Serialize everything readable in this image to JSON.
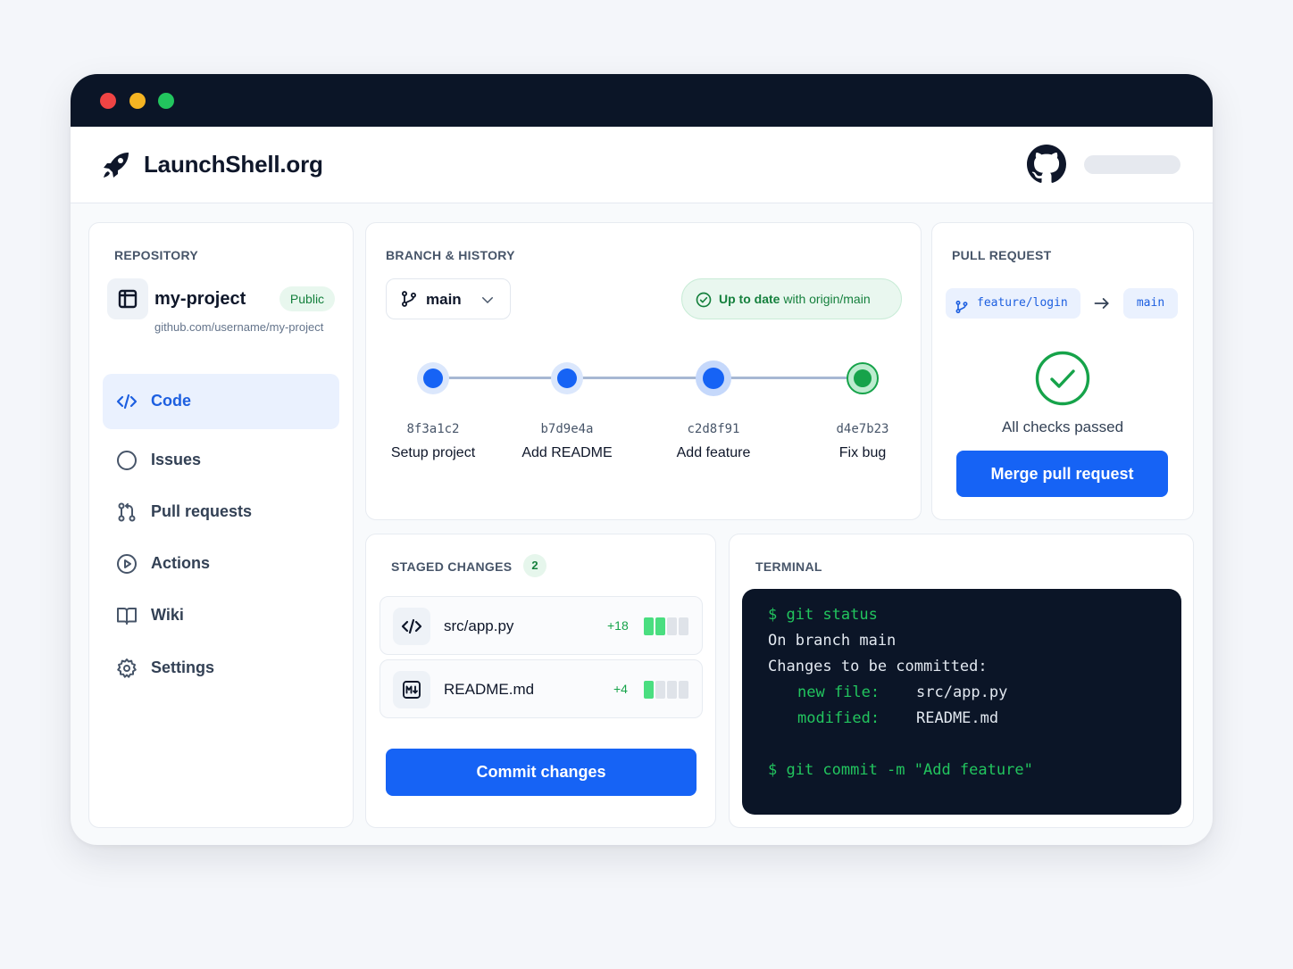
{
  "app": {
    "title": "LaunchShell.org",
    "accent_color": "#1663f5",
    "success_color": "#16a34a"
  },
  "repository": {
    "section_label": "REPOSITORY",
    "name": "my-project",
    "visibility": "Public",
    "url": "github.com/username/my-project",
    "nav": [
      {
        "label": "Code",
        "icon": "code-icon",
        "active": true
      },
      {
        "label": "Issues",
        "icon": "circle-icon",
        "active": false
      },
      {
        "label": "Pull requests",
        "icon": "pull-request-icon",
        "active": false
      },
      {
        "label": "Actions",
        "icon": "play-circle-icon",
        "active": false
      },
      {
        "label": "Wiki",
        "icon": "book-icon",
        "active": false
      },
      {
        "label": "Settings",
        "icon": "gear-icon",
        "active": false
      }
    ]
  },
  "branch": {
    "section_label": "BRANCH & HISTORY",
    "current": "main",
    "status_bold": "Up to date",
    "status_rest": " with origin/main",
    "commits": [
      {
        "hash": "8f3a1c2",
        "message": "Setup project"
      },
      {
        "hash": "b7d9e4a",
        "message": "Add README"
      },
      {
        "hash": "c2d8f91",
        "message": "Add feature"
      },
      {
        "hash": "d4e7b23",
        "message": "Fix bug"
      }
    ]
  },
  "pull_request": {
    "section_label": "PULL REQUEST",
    "source_branch": "feature/login",
    "target_branch": "main",
    "checks_text": "All checks passed",
    "merge_label": "Merge pull request"
  },
  "staged": {
    "section_label": "STAGED CHANGES",
    "count": "2",
    "files": [
      {
        "name": "src/app.py",
        "delta": "+18",
        "icon": "code-file-icon",
        "filled_bars": 2
      },
      {
        "name": "README.md",
        "delta": "+4",
        "icon": "markdown-file-icon",
        "filled_bars": 1
      }
    ],
    "commit_label": "Commit changes"
  },
  "terminal": {
    "section_label": "TERMINAL",
    "cmd1": "$ git status",
    "line_branch": "On branch main",
    "line_changes": "Changes to be committed:",
    "new_label": "new file:",
    "new_value": "src/app.py",
    "mod_label": "modified:",
    "mod_value": "README.md",
    "cmd2": "$ git commit -m \"Add feature\""
  }
}
